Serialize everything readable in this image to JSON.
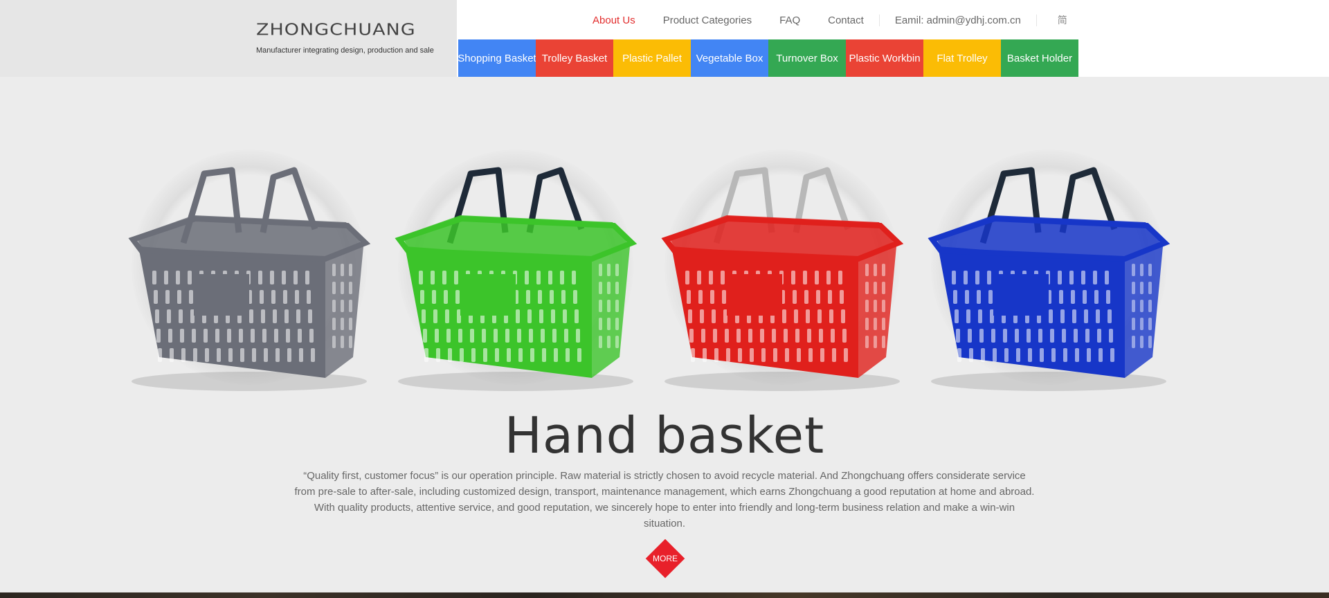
{
  "brand": {
    "logo": "ZHONGCHUANG",
    "tagline": "Manufacturer integrating design, production and sale"
  },
  "topnav": {
    "items": [
      "About Us",
      "Product Categories",
      "FAQ",
      "Contact"
    ],
    "email": "Eamil: admin@ydhj.com.cn",
    "lang": "简"
  },
  "catnav": [
    {
      "label": "Shopping Basket",
      "color": "#4285f4"
    },
    {
      "label": "Trolley Basket",
      "color": "#ea4335"
    },
    {
      "label": "Plastic Pallet",
      "color": "#fbbc05"
    },
    {
      "label": "Vegetable Box",
      "color": "#4285f4"
    },
    {
      "label": "Turnover Box",
      "color": "#34a853"
    },
    {
      "label": "Plastic Workbin",
      "color": "#ea4335"
    },
    {
      "label": "Flat Trolley",
      "color": "#fbbc05"
    },
    {
      "label": "Basket Holder",
      "color": "#34a853"
    }
  ],
  "hero": {
    "title": "Hand basket",
    "text": "“Quality first, customer focus” is our operation principle. Raw material is strictly chosen to avoid recycle material. And Zhongchuang offers considerate service from pre-sale to after-sale, including customized design, transport, maintenance management, which earns Zhongchuang a good reputation at home and abroad. With quality products, attentive service, and good reputation, we sincerely hope to enter into friendly and long-term business relation and make a win-win situation.",
    "more_label": "MORE",
    "baskets": [
      {
        "color": "#6b6e78",
        "handle": "#6b6e78",
        "name": "gray"
      },
      {
        "color": "#3cc42a",
        "handle": "#1e2a38",
        "name": "green"
      },
      {
        "color": "#e0201c",
        "handle": "#b8b8b8",
        "name": "red"
      },
      {
        "color": "#1736c8",
        "handle": "#1e2a38",
        "name": "blue"
      }
    ]
  }
}
